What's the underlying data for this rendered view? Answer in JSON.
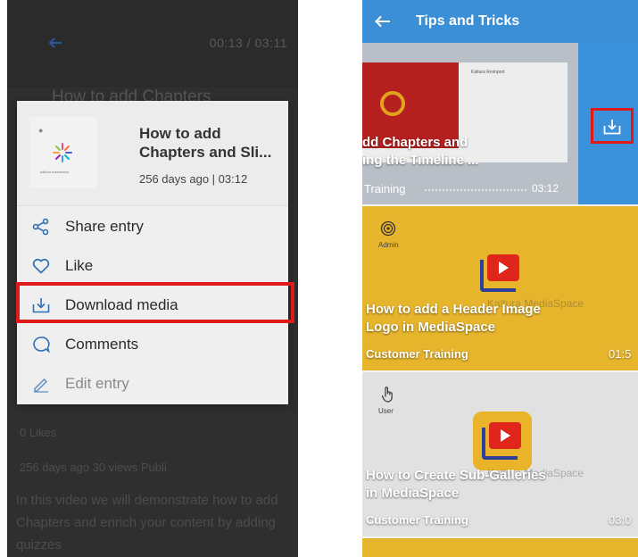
{
  "left": {
    "background": {
      "time": "00:13 / 03:11",
      "title": "How to add Chapters",
      "likes": "0 Likes",
      "stats": "256 days ago  30 views  Publi",
      "description": "In this video we will demonstrate how to add Chapters and enrich your content by adding quizzes"
    },
    "sheet": {
      "thumbnail_brand": "kaltura extensions",
      "title": "How to add\nChapters and Sli...",
      "meta": "256 days ago | 03:12",
      "items": [
        {
          "label": "Share entry",
          "icon": "share-icon"
        },
        {
          "label": "Like",
          "icon": "heart-icon"
        },
        {
          "label": "Download media",
          "icon": "download-icon"
        },
        {
          "label": "Comments",
          "icon": "comment-icon"
        },
        {
          "label": "Edit entry",
          "icon": "pencil-icon"
        }
      ]
    }
  },
  "right": {
    "appbar": {
      "title": "Tips and Tricks"
    },
    "cards": [
      {
        "slide_text": "Kaltura Reimport",
        "title": "dd Chapters and\ning the Timeline ...",
        "category": "Training",
        "duration": "03:12"
      },
      {
        "role": "Admin",
        "brand": "Kaltura MediaSpace",
        "title": "How to add a Header Image\nLogo in MediaSpace",
        "category": "Customer Training",
        "duration": "01:5"
      },
      {
        "role": "User",
        "brand": "Kaltura MediaSpace",
        "title": "How to Create Sub-Galleries\nin MediaSpace",
        "category": "Customer Training",
        "duration": "03:0"
      }
    ]
  },
  "colors": {
    "accent_blue": "#3b8fd6",
    "highlight_red": "#e01a1a",
    "card_yellow": "#e6b52c",
    "icon_blue": "#2f6fb5"
  }
}
